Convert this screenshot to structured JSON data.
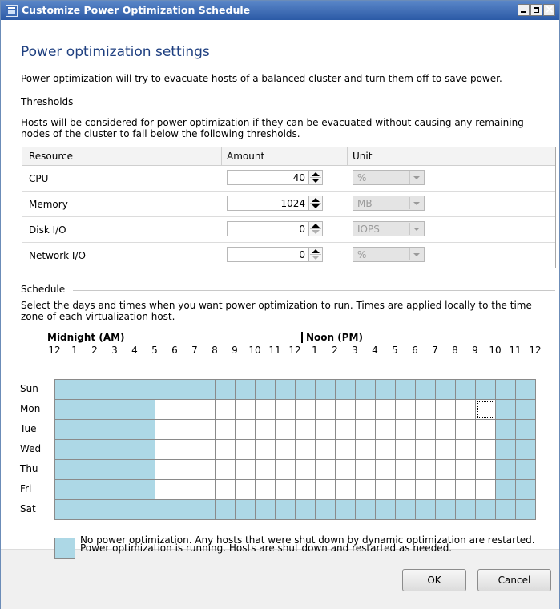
{
  "window": {
    "title": "Customize Power Optimization Schedule",
    "icon": "app-window-icon"
  },
  "page": {
    "heading": "Power optimization settings",
    "intro": "Power optimization will try to evacuate hosts of a balanced cluster and turn them off to save power."
  },
  "thresholds": {
    "label": "Thresholds",
    "description": "Hosts will be considered for power optimization if they can be evacuated without causing any remaining nodes of the cluster to fall below the following thresholds.",
    "columns": [
      "Resource",
      "Amount",
      "Unit"
    ],
    "rows": [
      {
        "resource": "CPU",
        "amount": "40",
        "unit": "%"
      },
      {
        "resource": "Memory",
        "amount": "1024",
        "unit": "MB"
      },
      {
        "resource": "Disk I/O",
        "amount": "0",
        "unit": "IOPS"
      },
      {
        "resource": "Network I/O",
        "amount": "0",
        "unit": "%"
      }
    ]
  },
  "schedule": {
    "label": "Schedule",
    "description": "Select the days and times when you want power optimization to run. Times are applied locally to the time zone of each virtualization host.",
    "midnight_label": "Midnight (AM)",
    "noon_label": "Noon (PM)",
    "hours": [
      "12",
      "1",
      "2",
      "3",
      "4",
      "5",
      "6",
      "7",
      "8",
      "9",
      "10",
      "11",
      "12",
      "1",
      "2",
      "3",
      "4",
      "5",
      "6",
      "7",
      "8",
      "9",
      "10",
      "11",
      "12"
    ],
    "days": [
      "Sun",
      "Mon",
      "Tue",
      "Wed",
      "Thu",
      "Fri",
      "Sat"
    ],
    "running_cells": [
      "111111111111111111111111",
      "111110000000000000000011",
      "111110000000000000000011",
      "111110000000000000000011",
      "111110000000000000000011",
      "111110000000000000000011",
      "111111111111111111111111"
    ],
    "focused_cell": {
      "day": "Mon",
      "hour_index": 21
    },
    "colors": {
      "running": "#add8e6",
      "off": "#ffffff"
    }
  },
  "legend": {
    "off_text": "No power optimization. Any hosts that were shut down by dynamic optimization are restarted.",
    "running_text": "Power optimization is running. Hosts are shut down and restarted as needed."
  },
  "buttons": {
    "ok": "OK",
    "cancel": "Cancel"
  }
}
